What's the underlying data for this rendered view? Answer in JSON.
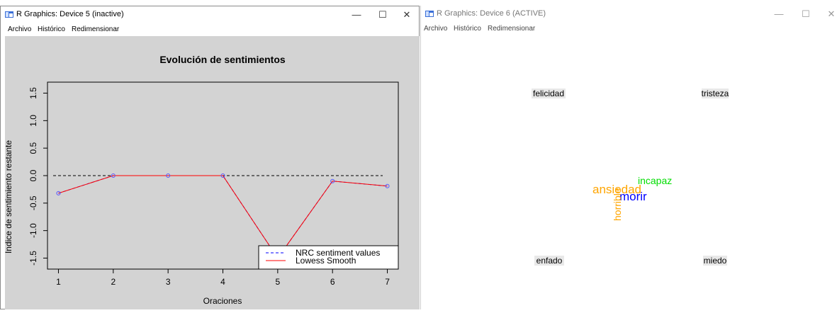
{
  "window_left": {
    "title": "R Graphics: Device 5 (inactive)",
    "menu": [
      "Archivo",
      "Histórico",
      "Redimensionar"
    ],
    "controls": {
      "minimize": "—",
      "maximize": "☐",
      "close": "✕"
    }
  },
  "window_right": {
    "title": "R Graphics: Device 6 (ACTIVE)",
    "menu": [
      "Archivo",
      "Histórico",
      "Redimensionar"
    ],
    "controls": {
      "minimize": "—",
      "maximize": "☐",
      "close": "✕"
    }
  },
  "chart_data": {
    "type": "line",
    "title": "Evolución de sentimientos",
    "xlabel": "Oraciones",
    "ylabel": "Índice de sentimiento restante",
    "x": [
      1,
      2,
      3,
      4,
      5,
      6,
      7
    ],
    "xticks": [
      "1",
      "2",
      "3",
      "4",
      "5",
      "6",
      "7"
    ],
    "yticks": [
      "-1.5",
      "-1.0",
      "-0.5",
      "0.0",
      "0.5",
      "1.0",
      "1.5"
    ],
    "xlim": [
      0.8,
      7.2
    ],
    "ylim": [
      -1.7,
      1.7
    ],
    "series": [
      {
        "name": "NRC sentiment values",
        "style": "dashed",
        "color": "#0000ff",
        "values": [
          -0.32,
          0.0,
          0.0,
          0.0,
          -1.5,
          -0.1,
          -0.19
        ]
      },
      {
        "name": "Lowess Smooth",
        "style": "solid",
        "color": "#ff0000",
        "values": [
          -0.32,
          0.0,
          0.0,
          0.0,
          -1.5,
          -0.1,
          -0.19
        ]
      }
    ],
    "reference_line": {
      "y": 0,
      "style": "dashed",
      "color": "#000000"
    },
    "legend": {
      "position": "bottom-right",
      "entries": [
        "NRC sentiment values",
        "Lowess Smooth"
      ]
    },
    "background": "#d3d3d3"
  },
  "wordcloud": {
    "groups": [
      {
        "label": "felicidad"
      },
      {
        "label": "tristeza"
      },
      {
        "label": "enfado"
      },
      {
        "label": "miedo"
      }
    ],
    "words": [
      {
        "text": "incapaz",
        "color": "#00dd00"
      },
      {
        "text": "ansiedad",
        "color": "#ffa500"
      },
      {
        "text": "morir",
        "color": "#0000ff"
      },
      {
        "text": "horrible",
        "color": "#ffa500"
      }
    ]
  }
}
